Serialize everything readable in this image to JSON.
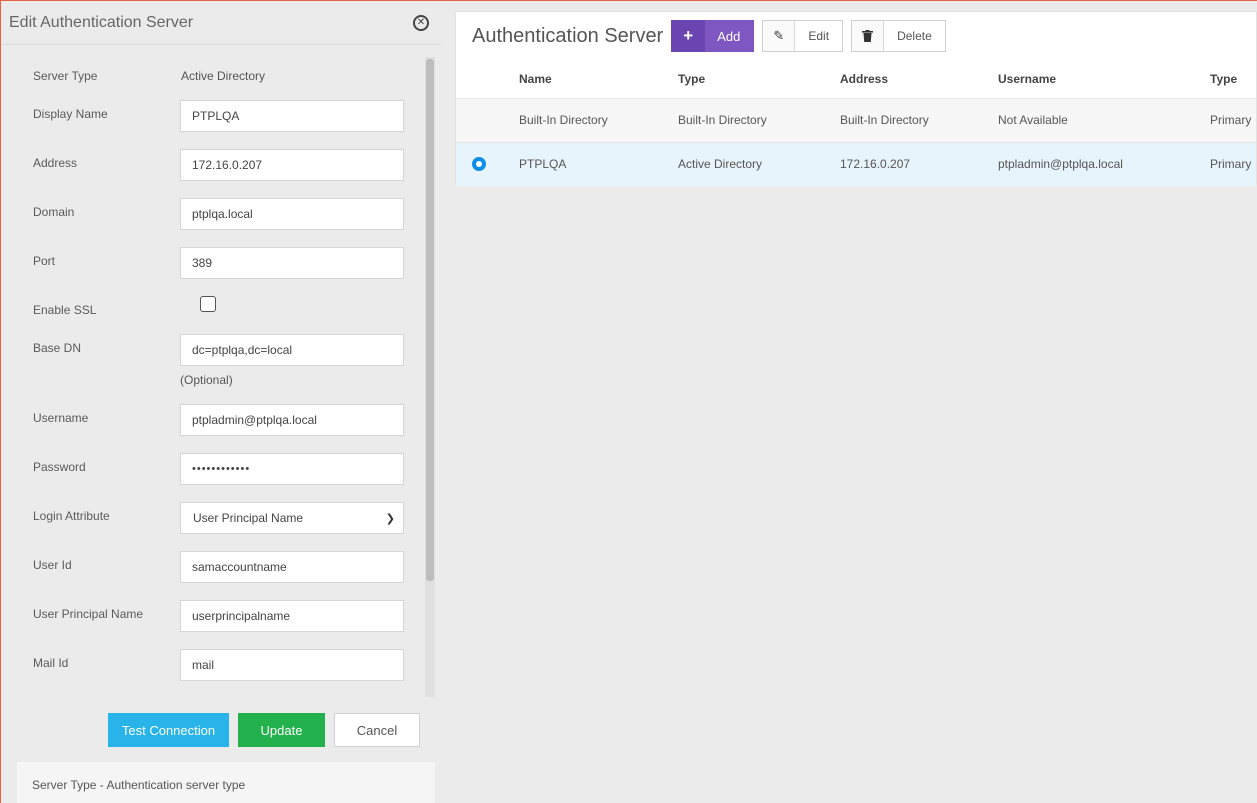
{
  "edit_panel": {
    "title": "Edit Authentication Server",
    "fields": {
      "server_type": {
        "label": "Server Type",
        "value": "Active Directory"
      },
      "display_name": {
        "label": "Display Name",
        "value": "PTPLQA"
      },
      "address": {
        "label": "Address",
        "value": "172.16.0.207"
      },
      "domain": {
        "label": "Domain",
        "value": "ptplqa.local"
      },
      "port": {
        "label": "Port",
        "value": "389"
      },
      "enable_ssl": {
        "label": "Enable SSL",
        "checked": false
      },
      "base_dn": {
        "label": "Base DN",
        "value": "dc=ptplqa,dc=local",
        "hint": "(Optional)"
      },
      "username": {
        "label": "Username",
        "value": "ptpladmin@ptplqa.local"
      },
      "password": {
        "label": "Password",
        "value": "••••••••••••"
      },
      "login_attribute": {
        "label": "Login Attribute",
        "value": "User Principal Name"
      },
      "user_id": {
        "label": "User Id",
        "value": "samaccountname"
      },
      "user_principal_name": {
        "label": "User Principal Name",
        "value": "userprincipalname"
      },
      "mail_id": {
        "label": "Mail Id",
        "value": "mail"
      }
    },
    "buttons": {
      "test": "Test Connection",
      "update": "Update",
      "cancel": "Cancel"
    },
    "help_text": "Server Type - Authentication server type"
  },
  "main": {
    "title": "Authentication Server",
    "toolbar": {
      "add": "Add",
      "edit": "Edit",
      "delete": "Delete"
    },
    "columns": [
      "Name",
      "Type",
      "Address",
      "Username",
      "Type"
    ],
    "rows": [
      {
        "name": "Built-In Directory",
        "type": "Built-In Directory",
        "address": "Built-In Directory",
        "username": "Not Available",
        "type2": "Primary",
        "selected": false
      },
      {
        "name": "PTPLQA",
        "type": "Active Directory",
        "address": "172.16.0.207",
        "username": "ptpladmin@ptplqa.local",
        "type2": "Primary",
        "selected": true
      }
    ]
  },
  "colors": {
    "accent_border": "#e8623e",
    "add_button": "#7e57c2",
    "test_button": "#28b4e8",
    "update_button": "#22b14c",
    "radio": "#0e8ee9"
  }
}
